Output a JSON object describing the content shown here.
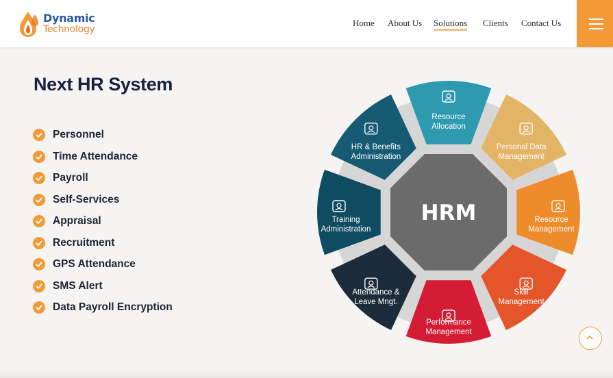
{
  "brand": {
    "name_line1": "Dynamic",
    "name_line2": "Technology",
    "logo_icon": "flame-drop-logo",
    "colors": {
      "blue": "#2b5aa6",
      "orange": "#f39a36"
    }
  },
  "nav": {
    "links": [
      {
        "label": "Home",
        "active": false
      },
      {
        "label": "About Us",
        "active": false
      },
      {
        "label": "Solutions",
        "active": true
      },
      {
        "label": "Clients",
        "active": false
      },
      {
        "label": "Contact Us",
        "active": false
      }
    ],
    "menu_icon": "hamburger-menu-icon"
  },
  "main": {
    "title": "Next HR System",
    "features": [
      "Personnel",
      "Time Attendance",
      "Payroll",
      "Self-Services",
      "Appraisal",
      "Recruitment",
      "GPS Attendance",
      "SMS Alert",
      "Data Payroll Encryption"
    ],
    "feature_icon": "check-circle-icon"
  },
  "diagram": {
    "center_label": "HRM",
    "center_color": "#6b6b6b",
    "segments": [
      {
        "line1": "Resource",
        "line2": "Allocation",
        "icon": "network-user-icon",
        "color": "#2e9ab0"
      },
      {
        "line1": "Personal Data",
        "line2": "Management",
        "icon": "database-icon",
        "color": "#e3b366"
      },
      {
        "line1": "Resource",
        "line2": "Management",
        "icon": "team-folder-icon",
        "color": "#ee8c2c"
      },
      {
        "line1": "Skill",
        "line2": "Management",
        "icon": "target-person-icon",
        "color": "#e4552a"
      },
      {
        "line1": "Performance",
        "line2": "Management",
        "icon": "line-chart-icon",
        "color": "#d41c35"
      },
      {
        "line1": "Attendance &",
        "line2": "Leave Mngt.",
        "icon": "calendar-icon",
        "color": "#1d2c3b"
      },
      {
        "line1": "Training",
        "line2": "Administration",
        "icon": "presentation-board-icon",
        "color": "#0f4b61"
      },
      {
        "line1": "HR & Benefits",
        "line2": "Administration",
        "icon": "gear-people-icon",
        "color": "#165a74"
      }
    ]
  },
  "scroll_top_icon": "chevron-up-icon"
}
